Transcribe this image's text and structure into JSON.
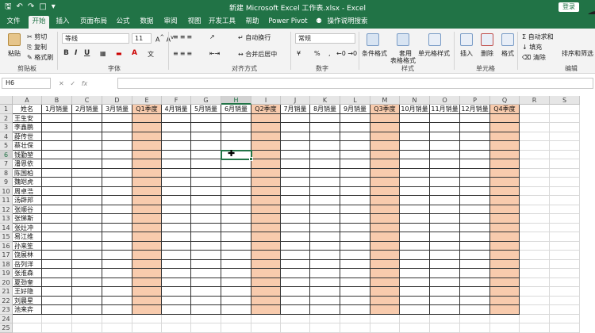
{
  "title": "新建 Microsoft Excel 工作表.xlsx  -  Excel",
  "login_label": "登录",
  "float_label": "00",
  "tabs": [
    "文件",
    "开始",
    "插入",
    "页面布局",
    "公式",
    "数据",
    "审阅",
    "视图",
    "开发工具",
    "帮助",
    "Power Pivot",
    "操作说明搜索"
  ],
  "ribbon": {
    "paste": "粘贴",
    "cut": "剪切",
    "copy": "复制",
    "format_painter": "格式刷",
    "clipboard_label": "剪贴板",
    "font_name": "等线",
    "font_size": "11",
    "font_label": "字体",
    "wrap_text": "自动换行",
    "merge_center": "合并后居中",
    "align_label": "对齐方式",
    "number_format": "常规",
    "number_label": "数字",
    "cond_format": "条件格式",
    "table_format_1": "套用",
    "table_format_2": "表格格式",
    "cell_style": "单元格样式",
    "style_label": "样式",
    "insert": "插入",
    "delete": "删除",
    "format": "格式",
    "cells_label": "单元格",
    "autosum": "自动求和",
    "fill": "填充",
    "clear": "清除",
    "sort_filter": "排序和筛选",
    "edit_label": "编辑"
  },
  "formula_bar": {
    "name_box": "H6",
    "fx": "fx",
    "value": ""
  },
  "columns": [
    "A",
    "B",
    "C",
    "D",
    "E",
    "F",
    "G",
    "H",
    "I",
    "J",
    "K",
    "L",
    "M",
    "N",
    "O",
    "P",
    "Q",
    "R",
    "S"
  ],
  "header_row": [
    "姓名",
    "1月销量",
    "2月销量",
    "3月销量",
    "Q1季度",
    "4月销量",
    "5月销量",
    "6月销量",
    "Q2季度",
    "7月销量",
    "8月销量",
    "9月销量",
    "Q3季度",
    "10月销量",
    "11月销量",
    "12月销量",
    "Q4季度",
    "",
    ""
  ],
  "names": [
    "王生安",
    "李鑫鹏",
    "薛传世",
    "蔡壮保",
    "钱勤堃",
    "潘恩依",
    "陈国柏",
    "魏皑虎",
    "周卓浩",
    "汤辟邦",
    "张顺谷",
    "张悌斯",
    "张灶冲",
    "易江维",
    "孙来笙",
    "饶展林",
    "岳列洋",
    "张淮森",
    "夏劲奎",
    "王好隐",
    "刘晨星",
    "池来弈"
  ],
  "row_numbers": [
    "1",
    "2",
    "3",
    "4",
    "5",
    "6",
    "7",
    "8",
    "9",
    "10",
    "11",
    "12",
    "13",
    "14",
    "15",
    "16",
    "17",
    "18",
    "19",
    "20",
    "21",
    "22",
    "23",
    "24",
    "25"
  ],
  "active_cell": "H6",
  "colors": {
    "excel_green": "#217346",
    "quarter_fill": "#f8cbad"
  }
}
